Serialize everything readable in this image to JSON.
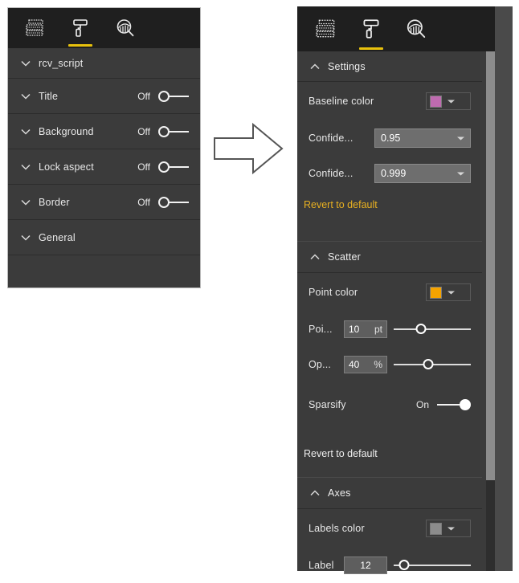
{
  "toolbar": {
    "tabs": [
      {
        "name": "fields-tab",
        "icon": "fields-table-icon",
        "selected": false
      },
      {
        "name": "format-tab",
        "icon": "paint-roller-icon",
        "selected": true
      },
      {
        "name": "analytics-tab",
        "icon": "chart-magnifier-icon",
        "selected": false
      }
    ],
    "accent_color": "#e8c10c"
  },
  "left_panel": {
    "rows": [
      {
        "label": "rcv_script",
        "chevron": "chevron-down-icon",
        "state": null,
        "toggle": null
      },
      {
        "label": "Title",
        "chevron": "chevron-down-icon",
        "state": "Off",
        "toggle": "off"
      },
      {
        "label": "Background",
        "chevron": "chevron-down-icon",
        "state": "Off",
        "toggle": "off"
      },
      {
        "label": "Lock aspect",
        "chevron": "chevron-down-icon",
        "state": "Off",
        "toggle": "off"
      },
      {
        "label": "Border",
        "chevron": "chevron-down-icon",
        "state": "Off",
        "toggle": "off"
      },
      {
        "label": "General",
        "chevron": "chevron-down-icon",
        "state": null,
        "toggle": null
      }
    ]
  },
  "right_panel": {
    "sections": {
      "settings": {
        "label": "Settings",
        "chevron": "chevron-up-icon"
      },
      "scatter": {
        "label": "Scatter",
        "chevron": "chevron-up-icon"
      },
      "axes": {
        "label": "Axes",
        "chevron": "chevron-up-icon"
      }
    },
    "settings_rows": {
      "baseline_color": {
        "label": "Baseline color",
        "swatch": "#bf6bb0"
      },
      "confidence_1": {
        "label": "Confide...",
        "value": "0.95"
      },
      "confidence_2": {
        "label": "Confide...",
        "value": "0.999"
      }
    },
    "scatter_rows": {
      "point_color": {
        "label": "Point color",
        "swatch": "#f5a300"
      },
      "point_size": {
        "label": "Poi...",
        "value": "10",
        "unit": "pt",
        "slider_pct": 35
      },
      "opacity": {
        "label": "Op...",
        "value": "40",
        "unit": "%",
        "slider_pct": 45
      },
      "sparsify": {
        "label": "Sparsify",
        "state": "On",
        "toggle": "on"
      }
    },
    "axes_rows": {
      "labels_color": {
        "label": "Labels color",
        "swatch": "#8c8c8c"
      },
      "label_size": {
        "label": "Label",
        "value": "12",
        "slider_pct": 14
      }
    },
    "revert_settings": "Revert to default",
    "revert_scatter": "Revert to default"
  },
  "arrow": {
    "name": "right-arrow-illustration"
  }
}
